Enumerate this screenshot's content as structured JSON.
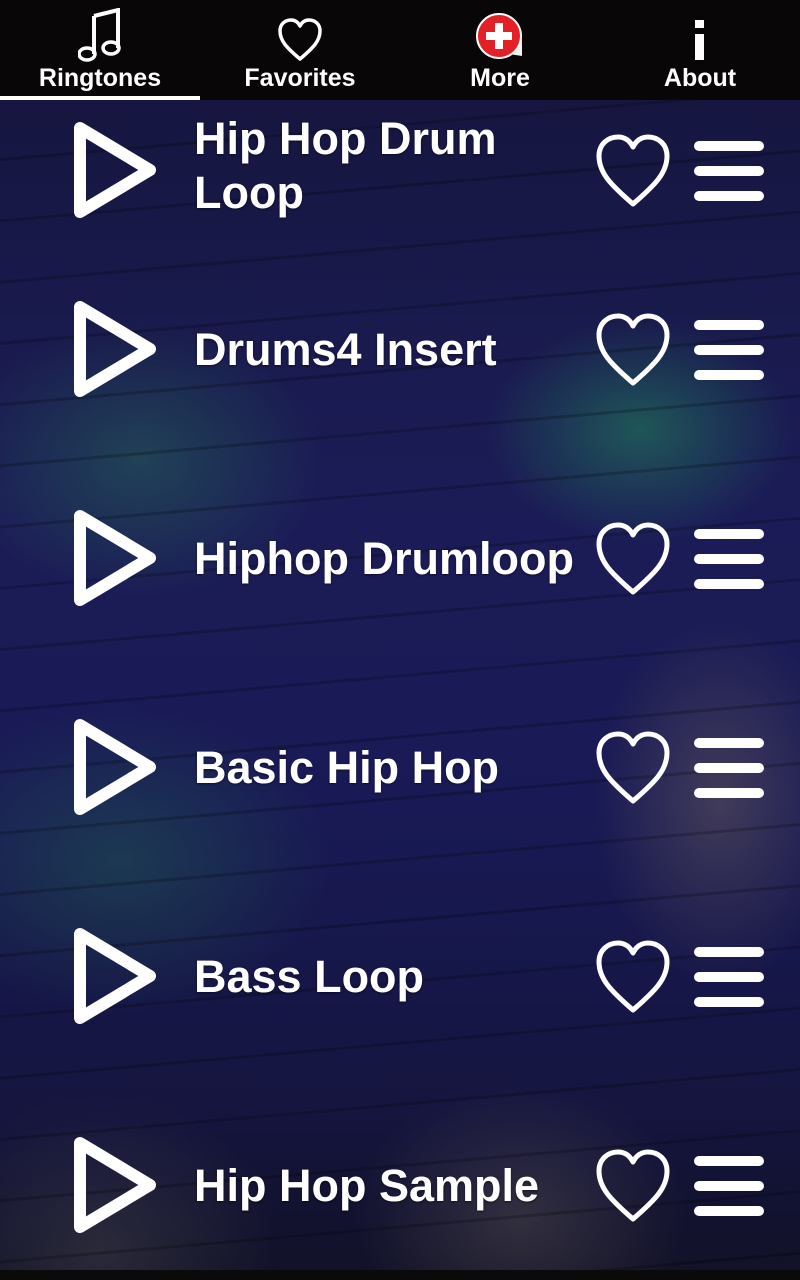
{
  "tabs": [
    {
      "label": "Ringtones",
      "icon": "music-note-icon",
      "selected": true
    },
    {
      "label": "Favorites",
      "icon": "heart-outline-icon",
      "selected": false
    },
    {
      "label": "More",
      "icon": "red-plus-badge-icon",
      "selected": false
    },
    {
      "label": "About",
      "icon": "info-icon",
      "selected": false
    }
  ],
  "ringtones": [
    {
      "title": "Hip Hop Drum Loop"
    },
    {
      "title": "Drums4 Insert"
    },
    {
      "title": "Hiphop Drumloop"
    },
    {
      "title": "Basic Hip Hop"
    },
    {
      "title": "Bass Loop"
    },
    {
      "title": "Hip Hop Sample"
    }
  ],
  "colors": {
    "tabbar_bg": "#080606",
    "text": "#ffffff",
    "more_badge": "#e32026",
    "bg_blue": "#22236b",
    "bg_teal": "#28826e"
  }
}
